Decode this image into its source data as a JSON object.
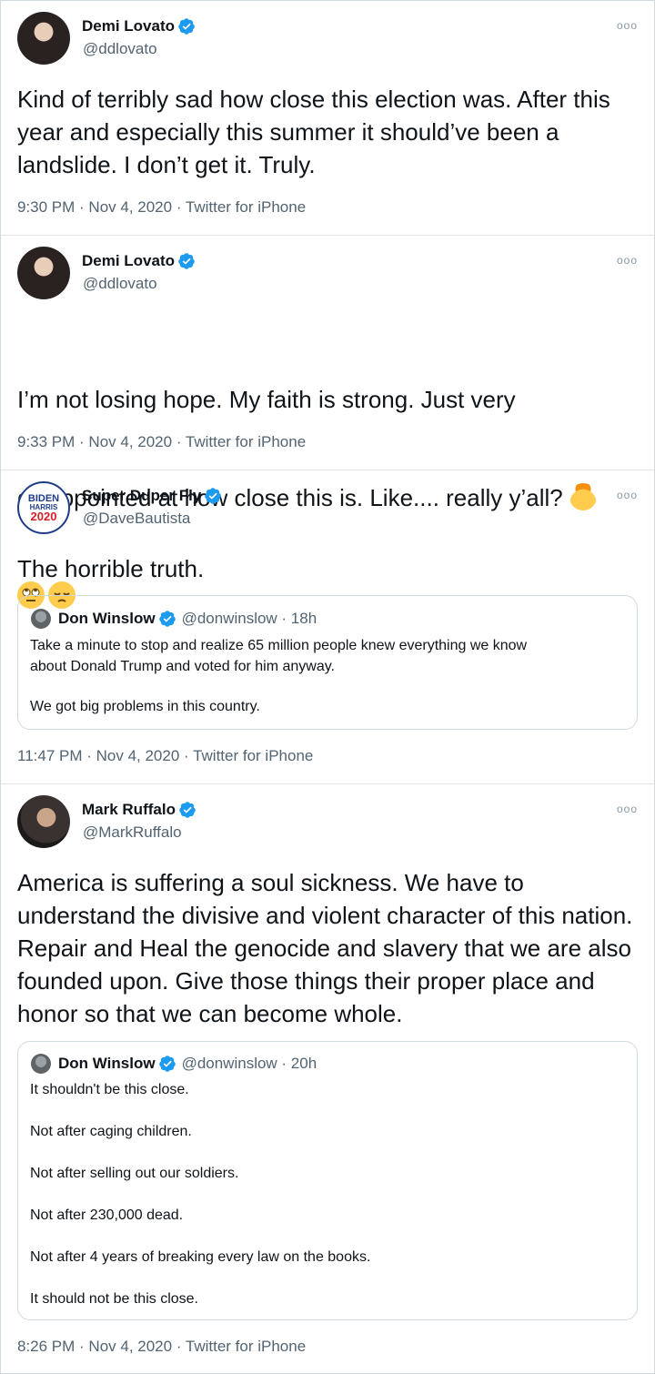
{
  "tweets": [
    {
      "name": "Demi Lovato",
      "handle": "@ddlovato",
      "text": "Kind of terribly sad how close this election was. After this year and especially this summer it should’ve been a landslide. I don’t get it. Truly.",
      "meta": "9:30 PM · Nov 4, 2020 · Twitter for iPhone"
    },
    {
      "name": "Demi Lovato",
      "handle": "@ddlovato",
      "text_line1": "I’m not losing hope. My faith is strong. Just very",
      "text_line2": "disappointed at how close this is. Like.... really y’all?",
      "emojis": [
        "exploding-head-emoji",
        "face-with-rolling-eyes-emoji",
        "pensive-face-emoji"
      ],
      "meta": "9:33 PM · Nov 4, 2020 · Twitter for iPhone"
    },
    {
      "name": "Super Duper Fly",
      "handle": "@DaveBautista",
      "avatar_text": [
        "BIDEN",
        "HARRIS",
        "2020"
      ],
      "text": "The horrible truth.",
      "quote": {
        "name": "Don Winslow",
        "handle_time": "@donwinslow · 18h",
        "lines": [
          "Take a minute to stop and realize 65 million people knew everything we know",
          "about Donald Trump and voted for him anyway.",
          "We got big problems in this country."
        ]
      },
      "meta": "11:47 PM · Nov 4, 2020 · Twitter for iPhone"
    },
    {
      "name": "Mark Ruffalo",
      "handle": "@MarkRuffalo",
      "text": "America is suffering a soul sickness. We have to understand the divisive and violent character of this nation. Repair and Heal the genocide and slavery that we are also founded upon. Give those things their proper place and honor so that we can become whole.",
      "quote": {
        "name": "Don Winslow",
        "handle_time": "@donwinslow · 20h",
        "lines": [
          "It shouldn't be this close.",
          "Not after caging children.",
          "Not after selling out our soldiers.",
          "Not after 230,000 dead.",
          "Not after 4 years of breaking every law on the books.",
          "It should not be this close."
        ]
      },
      "meta": "8:26 PM · Nov 4, 2020 · Twitter for iPhone"
    }
  ],
  "more_label": "ooo",
  "colors": {
    "verified": "#1d9bf0",
    "biden_blue": "#1f3c88",
    "biden_red": "#d71f26"
  }
}
